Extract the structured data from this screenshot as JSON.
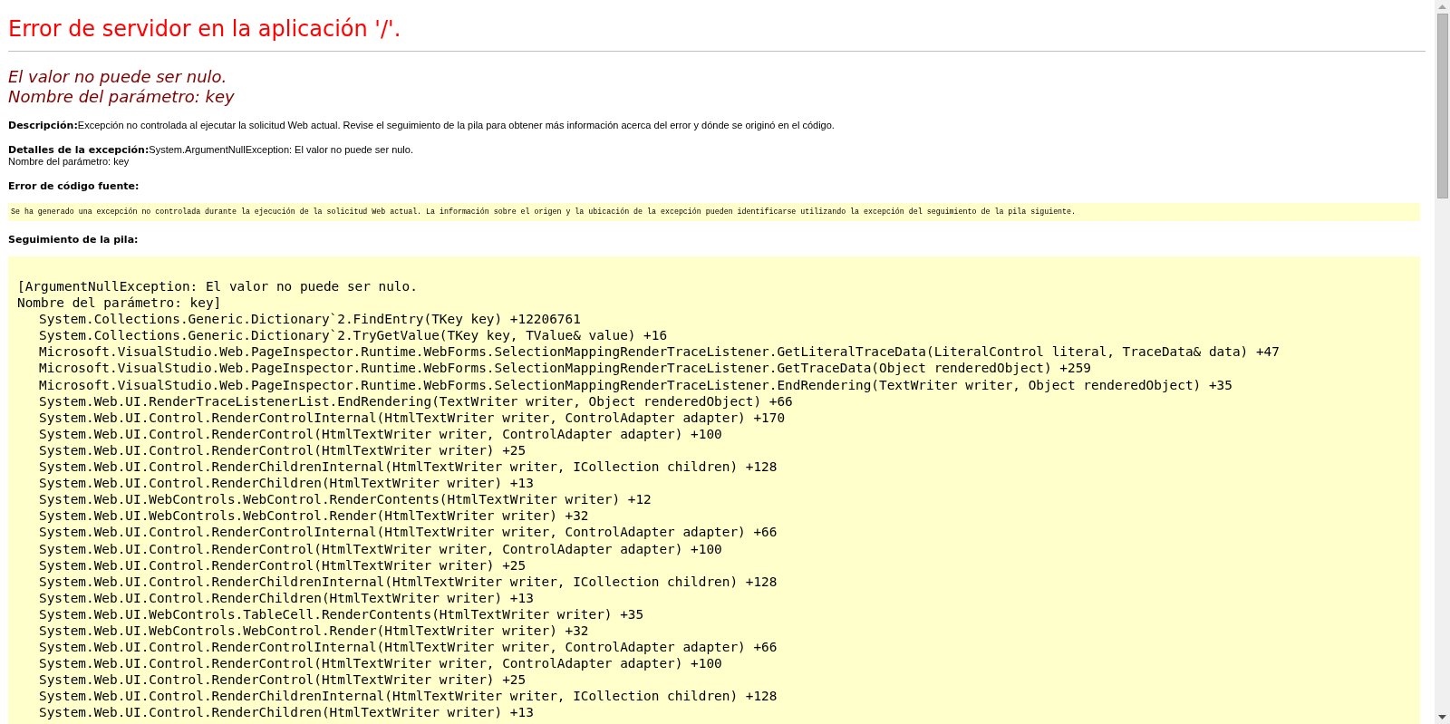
{
  "title": "Error de servidor en la aplicación '/'.",
  "error_message": [
    "El valor no puede ser nulo.",
    "Nombre del parámetro: key"
  ],
  "description": {
    "label": "Descripción:",
    "text": "Excepción no controlada al ejecutar la solicitud Web actual. Revise el seguimiento de la pila para obtener más información acerca del error y dónde se originó en el código."
  },
  "exception_details": {
    "label": "Detalles de la excepción:",
    "text": "System.ArgumentNullException: El valor no puede ser nulo.",
    "text_2": "Nombre del parámetro: key"
  },
  "source_error": {
    "label": "Error de código fuente:",
    "text": "Se ha generado una excepción no controlada durante la ejecución de la solicitud Web actual. La información sobre el origen y la ubicación de la excepción pueden identificarse utilizando la excepción del seguimiento de la pila siguiente."
  },
  "stack_trace": {
    "label": "Seguimiento de la pila:",
    "header": [
      "[ArgumentNullException: El valor no puede ser nulo.",
      "Nombre del parámetro: key]"
    ],
    "frames": [
      "System.Collections.Generic.Dictionary`2.FindEntry(TKey key) +12206761",
      "System.Collections.Generic.Dictionary`2.TryGetValue(TKey key, TValue& value) +16",
      "Microsoft.VisualStudio.Web.PageInspector.Runtime.WebForms.SelectionMappingRenderTraceListener.GetLiteralTraceData(LiteralControl literal, TraceData& data) +47",
      "Microsoft.VisualStudio.Web.PageInspector.Runtime.WebForms.SelectionMappingRenderTraceListener.GetTraceData(Object renderedObject) +259",
      "Microsoft.VisualStudio.Web.PageInspector.Runtime.WebForms.SelectionMappingRenderTraceListener.EndRendering(TextWriter writer, Object renderedObject) +35",
      "System.Web.UI.RenderTraceListenerList.EndRendering(TextWriter writer, Object renderedObject) +66",
      "System.Web.UI.Control.RenderControlInternal(HtmlTextWriter writer, ControlAdapter adapter) +170",
      "System.Web.UI.Control.RenderControl(HtmlTextWriter writer, ControlAdapter adapter) +100",
      "System.Web.UI.Control.RenderControl(HtmlTextWriter writer) +25",
      "System.Web.UI.Control.RenderChildrenInternal(HtmlTextWriter writer, ICollection children) +128",
      "System.Web.UI.Control.RenderChildren(HtmlTextWriter writer) +13",
      "System.Web.UI.WebControls.WebControl.RenderContents(HtmlTextWriter writer) +12",
      "System.Web.UI.WebControls.WebControl.Render(HtmlTextWriter writer) +32",
      "System.Web.UI.Control.RenderControlInternal(HtmlTextWriter writer, ControlAdapter adapter) +66",
      "System.Web.UI.Control.RenderControl(HtmlTextWriter writer, ControlAdapter adapter) +100",
      "System.Web.UI.Control.RenderControl(HtmlTextWriter writer) +25",
      "System.Web.UI.Control.RenderChildrenInternal(HtmlTextWriter writer, ICollection children) +128",
      "System.Web.UI.Control.RenderChildren(HtmlTextWriter writer) +13",
      "System.Web.UI.WebControls.TableCell.RenderContents(HtmlTextWriter writer) +35",
      "System.Web.UI.WebControls.WebControl.Render(HtmlTextWriter writer) +32",
      "System.Web.UI.Control.RenderControlInternal(HtmlTextWriter writer, ControlAdapter adapter) +66",
      "System.Web.UI.Control.RenderControl(HtmlTextWriter writer, ControlAdapter adapter) +100",
      "System.Web.UI.Control.RenderControl(HtmlTextWriter writer) +25",
      "System.Web.UI.Control.RenderChildrenInternal(HtmlTextWriter writer, ICollection children) +128",
      "System.Web.UI.Control.RenderChildren(HtmlTextWriter writer) +13"
    ]
  }
}
